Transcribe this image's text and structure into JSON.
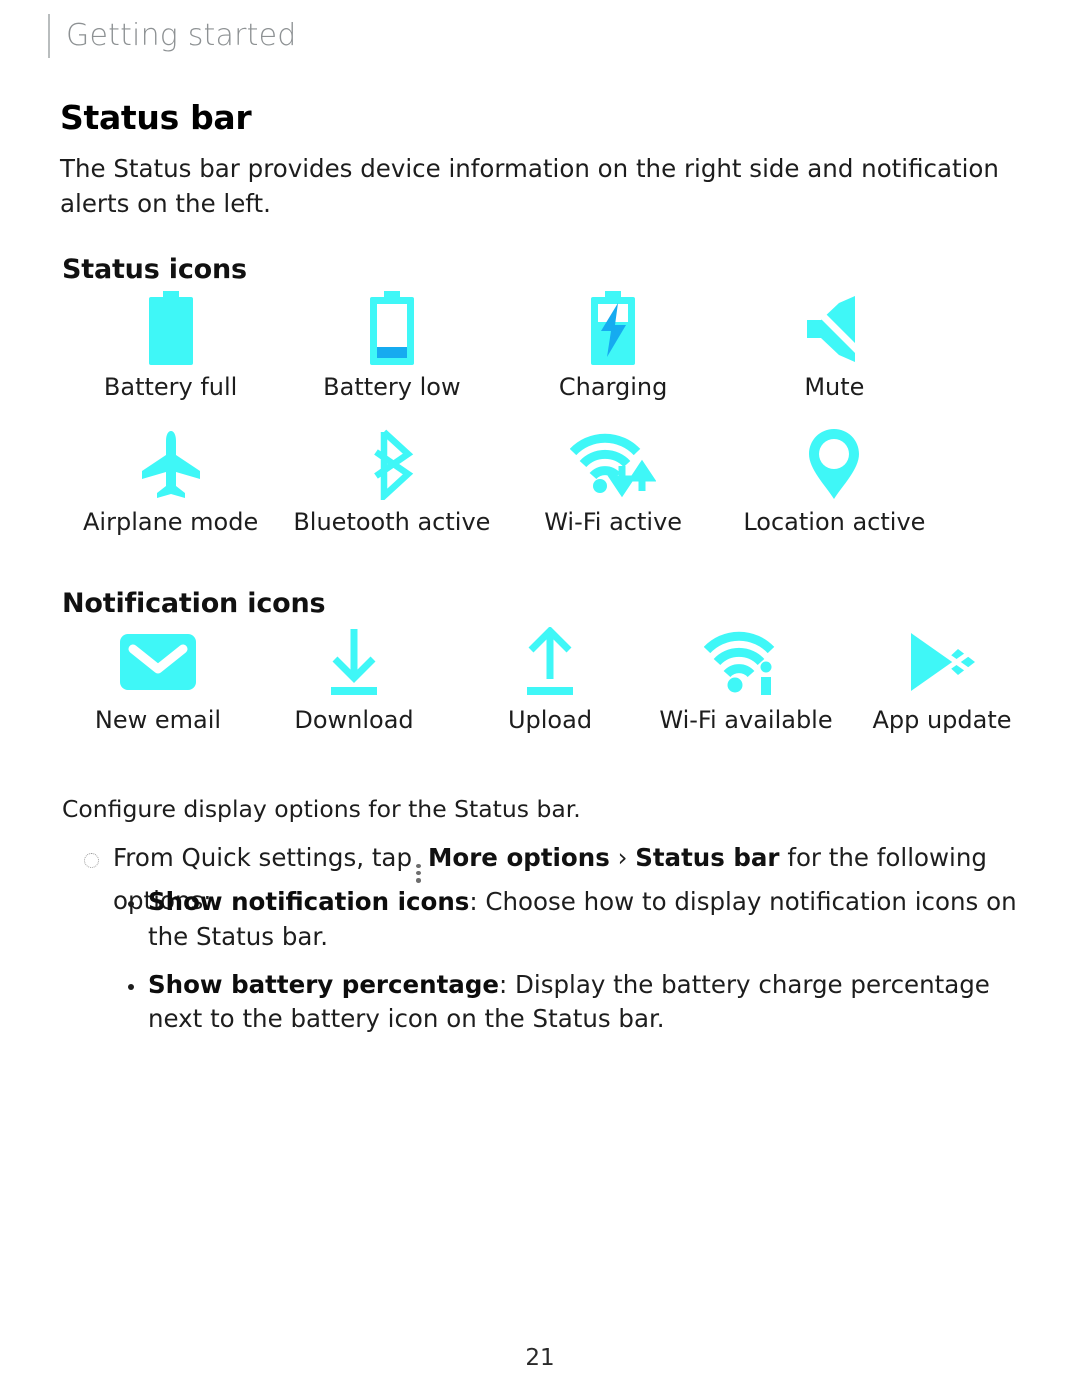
{
  "header": {
    "title": "Getting started"
  },
  "page_title": "Status bar",
  "intro": "The Status bar provides device information on the right side and notification alerts on the left.",
  "sections": {
    "status_icons_heading": "Status icons",
    "notification_icons_heading": "Notification icons"
  },
  "status_icons_row1": [
    {
      "icon": "battery-full-icon",
      "label": "Battery full"
    },
    {
      "icon": "battery-low-icon",
      "label": "Battery low"
    },
    {
      "icon": "battery-charging-icon",
      "label": "Charging"
    },
    {
      "icon": "mute-icon",
      "label": "Mute"
    }
  ],
  "status_icons_row2": [
    {
      "icon": "airplane-mode-icon",
      "label": "Airplane mode"
    },
    {
      "icon": "bluetooth-icon",
      "label": "Bluetooth active"
    },
    {
      "icon": "wifi-active-icon",
      "label": "Wi-Fi active"
    },
    {
      "icon": "location-pin-icon",
      "label": "Location active"
    }
  ],
  "notification_icons": [
    {
      "icon": "envelope-icon",
      "label": "New email"
    },
    {
      "icon": "download-arrow-icon",
      "label": "Download"
    },
    {
      "icon": "upload-arrow-icon",
      "label": "Upload"
    },
    {
      "icon": "wifi-available-icon",
      "label": "Wi-Fi available"
    },
    {
      "icon": "play-store-icon",
      "label": "App update"
    }
  ],
  "body": {
    "configure_line": "Configure display options for the Status bar.",
    "step": {
      "bullet": "hollow-dotted-circle-bullet",
      "text_before_icon": "From Quick settings, tap",
      "inline_icon": "more-options-kebab-icon",
      "bold_more_options": "More options",
      "separator": "›",
      "bold_status_bar": "Status bar",
      "text_after": "for the following options:"
    },
    "options": [
      {
        "term": "Show notification icons",
        "description": ": Choose how to display notification icons on the Status bar."
      },
      {
        "term": "Show battery percentage",
        "description": ": Display the battery charge percentage next to the battery icon on the Status bar."
      }
    ]
  },
  "footer": {
    "page_number": "21"
  },
  "colors": {
    "icon_cyan": "#3FF7F7",
    "icon_blue": "#16ABF0",
    "header_gray": "#8D9193",
    "text_black": "#1D1D1D"
  }
}
